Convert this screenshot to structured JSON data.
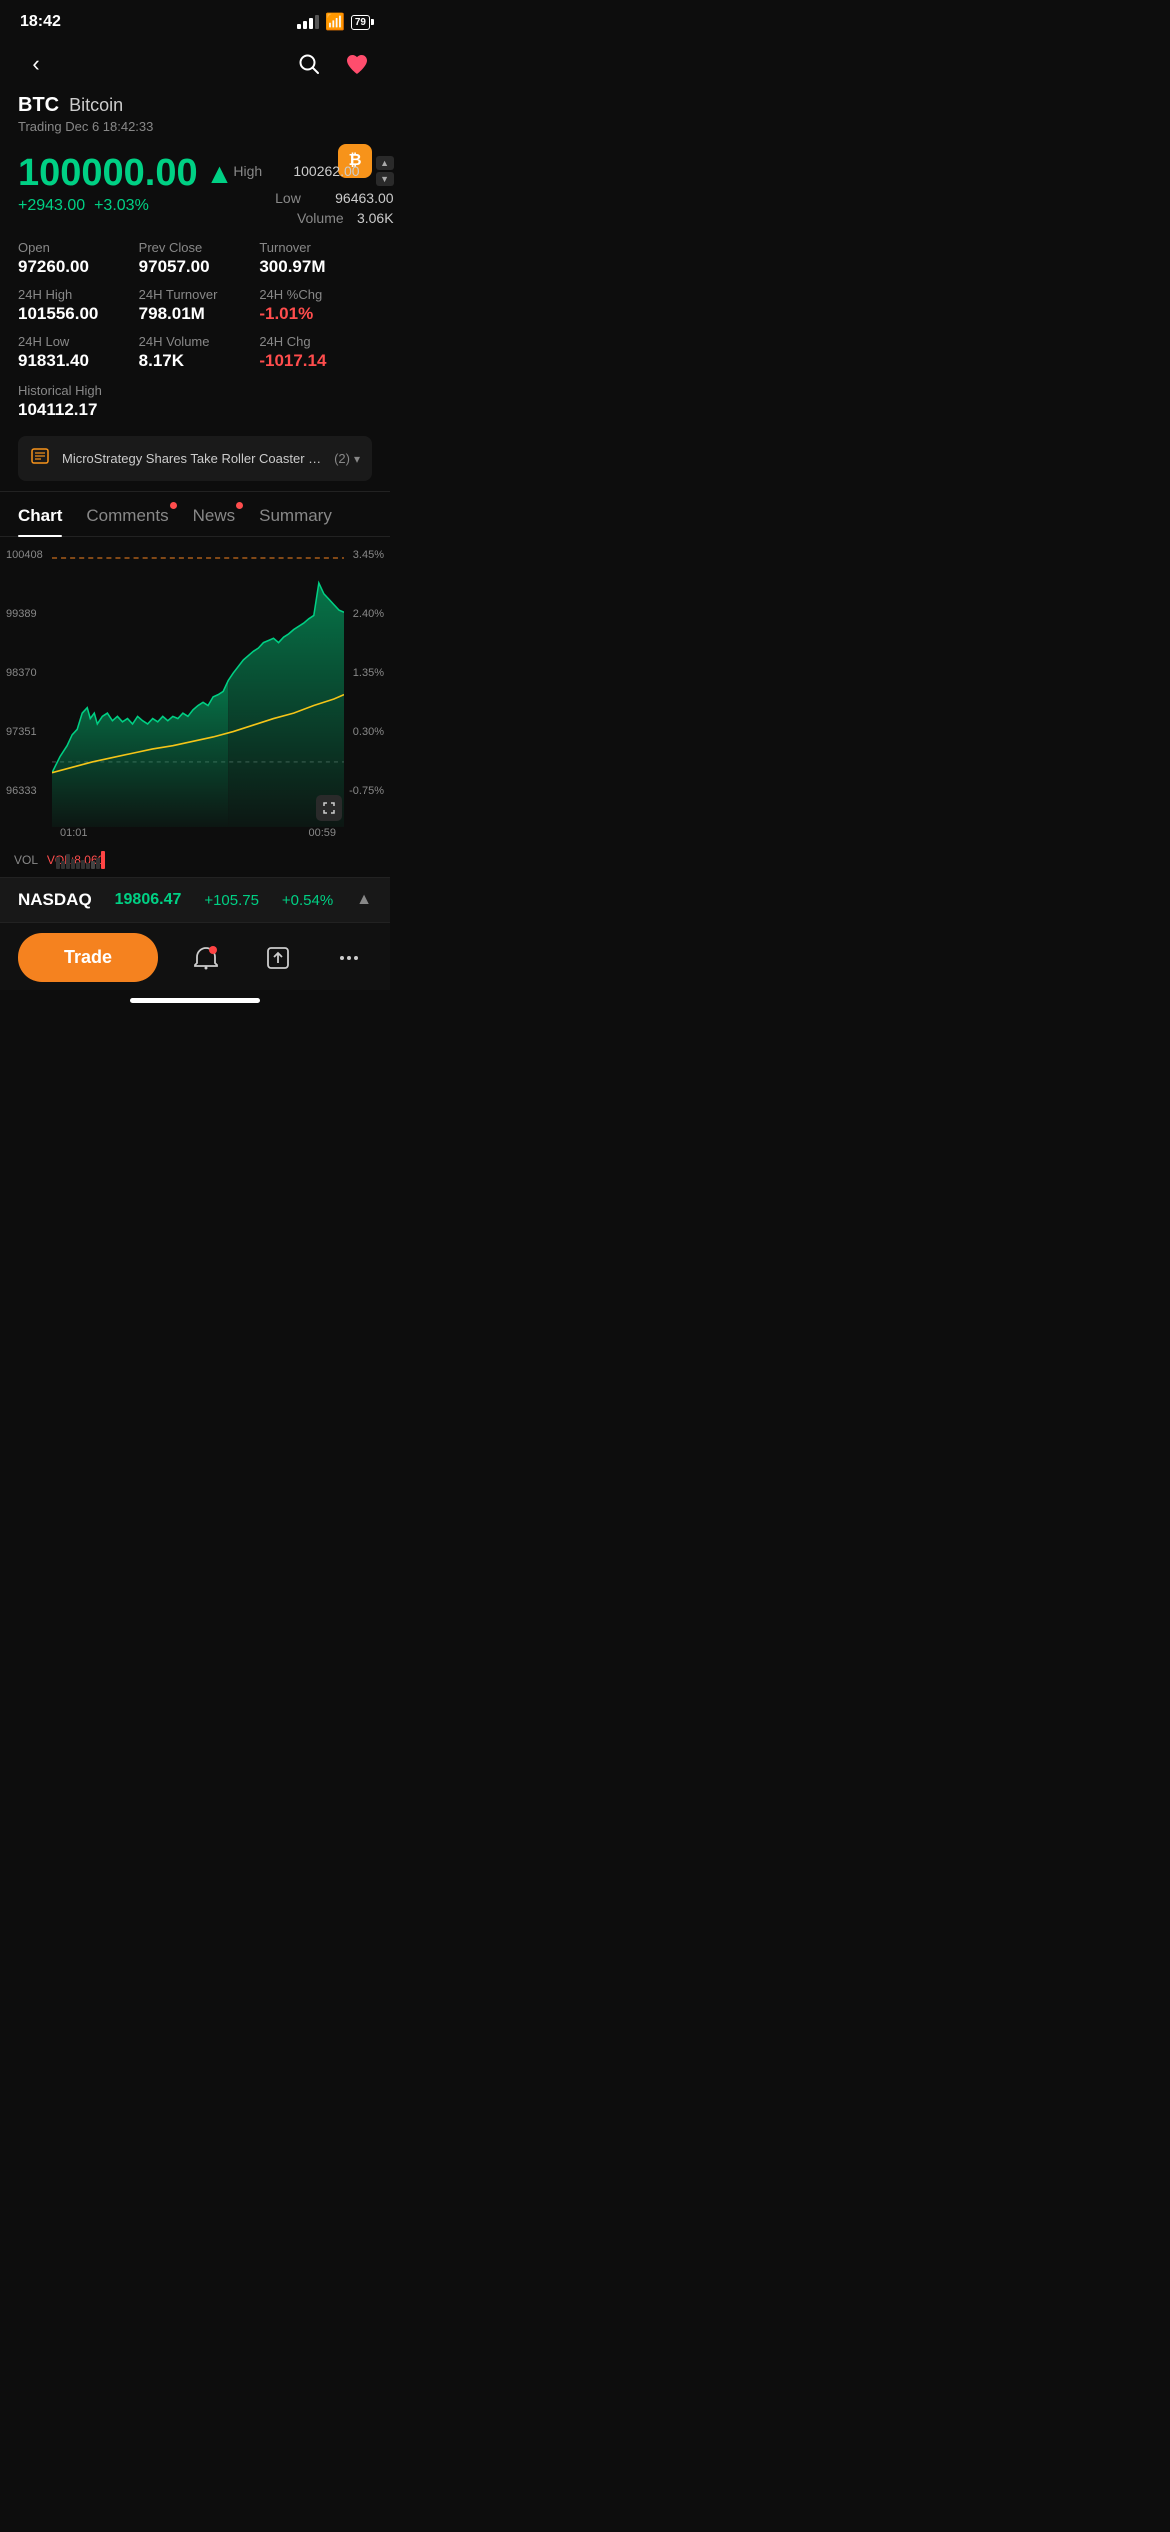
{
  "statusBar": {
    "time": "18:42",
    "battery": "79"
  },
  "header": {
    "backLabel": "‹",
    "searchLabel": "○",
    "heartLabel": "♥"
  },
  "coin": {
    "symbol": "BTC",
    "name": "Bitcoin",
    "tradingTime": "Trading Dec 6 18:42:33",
    "logoText": "₿"
  },
  "price": {
    "mainPrice": "100000.00",
    "arrow": "▲",
    "change": "+2943.00",
    "changePct": "+3.03%",
    "high": "100262.00",
    "low": "96463.00",
    "volume": "3.06K"
  },
  "stats": {
    "open": {
      "label": "Open",
      "value": "97260.00"
    },
    "prevClose": {
      "label": "Prev Close",
      "value": "97057.00"
    },
    "turnover": {
      "label": "Turnover",
      "value": "300.97M"
    },
    "h24High": {
      "label": "24H High",
      "value": "101556.00"
    },
    "h24Turnover": {
      "label": "24H Turnover",
      "value": "798.01M"
    },
    "h24PctChg": {
      "label": "24H %Chg",
      "value": "-1.01%"
    },
    "h24Low": {
      "label": "24H Low",
      "value": "91831.40"
    },
    "h24Volume": {
      "label": "24H Volume",
      "value": "8.17K"
    },
    "h24Chg": {
      "label": "24H Chg",
      "value": "-1017.14"
    },
    "histHigh": {
      "label": "Historical High",
      "value": "104112.17"
    }
  },
  "newsBanner": {
    "text": "MicroStrategy Shares Take Roller Coaster Ride, Driving...",
    "count": "(2)"
  },
  "tabs": [
    {
      "label": "Chart",
      "active": true,
      "dot": false
    },
    {
      "label": "Comments",
      "active": false,
      "dot": true
    },
    {
      "label": "News",
      "active": false,
      "dot": true
    },
    {
      "label": "Summary",
      "active": false,
      "dot": false
    }
  ],
  "chart": {
    "yLabels": [
      "100408",
      "99389",
      "98370",
      "97351",
      "96333"
    ],
    "yLabelsRight": [
      "3.45%",
      "2.40%",
      "1.35%",
      "0.30%",
      "-0.75%"
    ],
    "xTimeLeft": "01:01",
    "xTimeRight": "00:59",
    "volLabel": "VOL",
    "volValue": "VOL:8.060"
  },
  "nasdaq": {
    "name": "NASDAQ",
    "price": "19806.47",
    "change": "+105.75",
    "changePct": "+0.54%"
  },
  "bottomBar": {
    "tradeLabel": "Trade",
    "bellLabel": "🔔",
    "shareLabel": "⬆",
    "moreLabel": "⋯"
  }
}
